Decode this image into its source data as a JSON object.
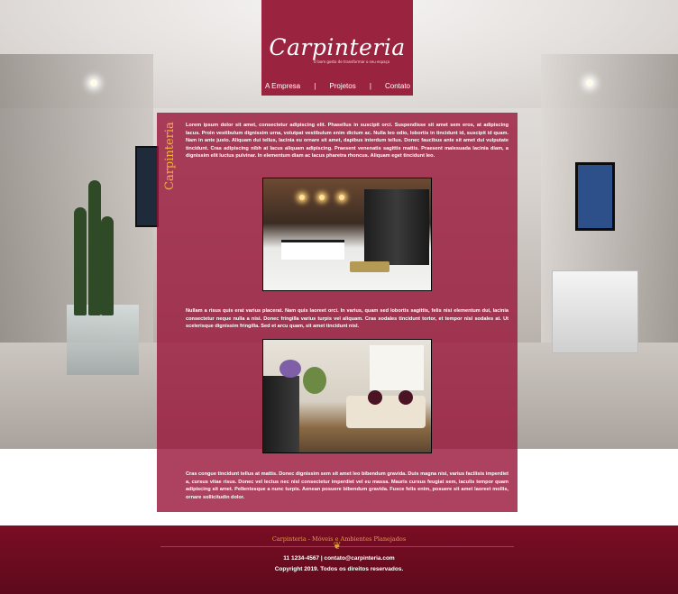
{
  "header": {
    "logo_text": "Carpinteria",
    "tagline": "O bom gosto de transformar o seu espaço",
    "nav": [
      {
        "label": "A Empresa"
      },
      {
        "label": "Projetos"
      },
      {
        "label": "Contato"
      }
    ],
    "nav_separator": "|"
  },
  "main": {
    "side_title": "Carpinteria",
    "paragraphs": [
      "Lorem ipsum dolor sit amet, consectetur adipiscing elit. Phasellus in suscipit orci. Suspendisse sit amet sem eros, at adipiscing lacus. Proin vestibulum dignissim urna, volutpat vestibulum enim dictum ac. Nulla leo odio, lobortis in tincidunt id, suscipit id quam. Nam in ante justo. Aliquam dui tellus, lacinia eu ornare sit amet, dapibus interdum tellus. Donec faucibus ante sit amet dui vulputate tincidunt. Cras adipiscing nibh at lacus aliquam adipiscing. Praesent venenatis sagittis mattis. Praesent malesuada lacinia diam, a dignissim elit luctus pulvinar. In elementum diam ac lacus pharetra rhoncus. Aliquam eget tincidunt leo.",
      "Nullam a risus quis erat varius placerat. Nam quis laoreet orci. In varius, quam sed lobortis sagittis, felis nisi elementum dui, lacinia consectetur neque nulla a nisi. Donec fringilla varius turpis vel aliquam. Cras sodales tincidunt tortor, et tempor nisl sodales at. Ut scelerisque dignissim fringilla. Sed et arcu quam, sit amet tincidunt nisl.",
      "Cras congue tincidunt tellus at mattis. Donec dignissim sem sit amet leo bibendum gravida. Duis magna nisi, varius facilisis imperdiet a, cursus vitae risus. Donec vel lectus nec nisl consectetur imperdiet vel eu massa. Mauris cursus feugiat sem, iaculis tempor quam adipiscing sit amet. Pellentesque a nunc turpis. Aenean posuere bibendum gravida. Fusce felis enim, posuere sit amet laoreet mollis, ornare sollicitudin dolor."
    ]
  },
  "footer": {
    "brand": "Carpinteria - Móveis e Ambientes Planejados",
    "ornament": "❦",
    "contact": "11 1234-4567 | contato@carpinteria.com",
    "copyright": "Copyright 2019. Todos os direitos reservados."
  },
  "colors": {
    "brand": "#9a2440",
    "footer": "#7a0d24",
    "accent_gold": "#f0b52a"
  }
}
